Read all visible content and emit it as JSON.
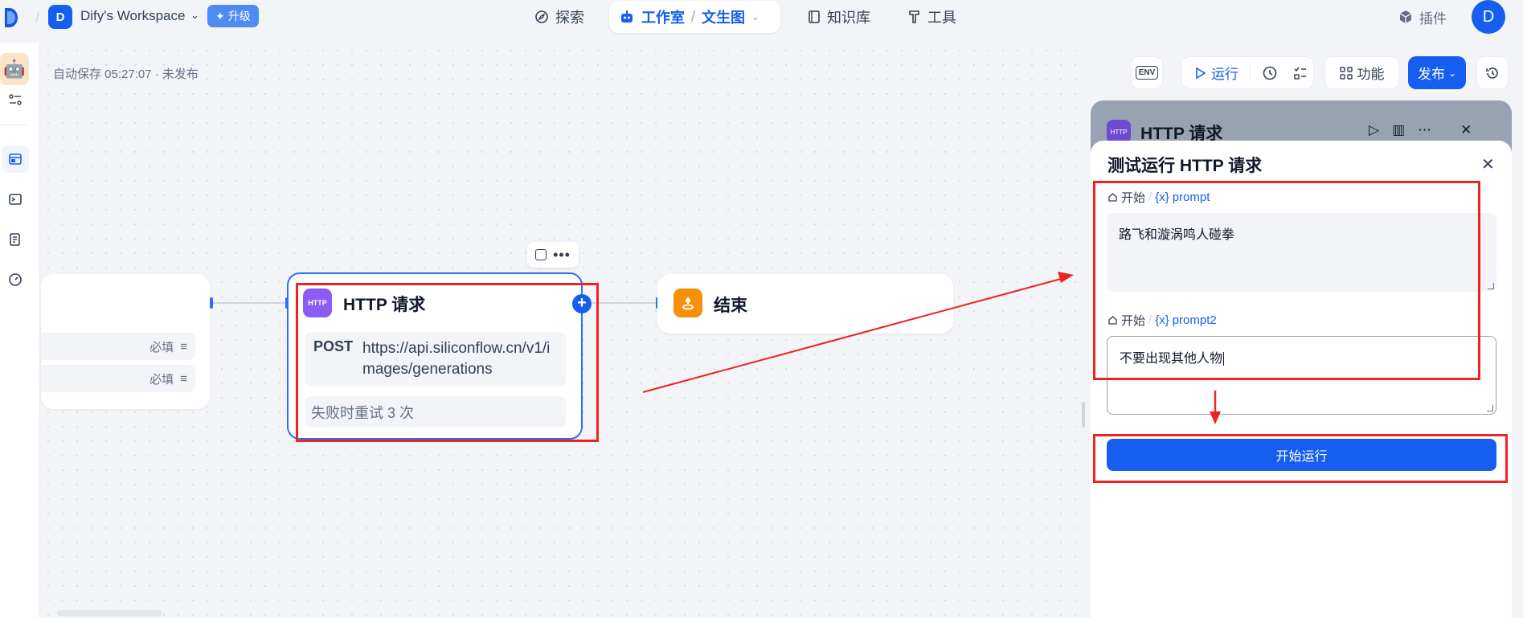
{
  "header": {
    "workspace_initial": "D",
    "workspace_name": "Dify's Workspace",
    "upgrade_label": "升级",
    "nav": {
      "explore": "探索",
      "studio": "工作室",
      "current_app": "文生图",
      "knowledge": "知识库",
      "tools": "工具",
      "plugins": "插件"
    },
    "user_initial": "D"
  },
  "canvas": {
    "autosave": "自动保存 05:27:07 · 未发布",
    "start_node": {
      "rows": [
        "必填",
        "必填"
      ]
    },
    "http_node": {
      "badge": "HTTP",
      "title": "HTTP 请求",
      "method": "POST",
      "url": "https://api.siliconflow.cn/v1/images/generations",
      "retry": "失败时重试 3 次"
    },
    "end_node": {
      "title": "结束"
    }
  },
  "toolbar": {
    "env": "ENV",
    "run": "运行",
    "features": "功能",
    "publish": "发布"
  },
  "panel": {
    "node_title": "HTTP 请求",
    "node_badge": "HTTP",
    "dialog_title": "测试运行 HTTP 请求",
    "fields": [
      {
        "source": "开始",
        "var": "prompt",
        "value": "路飞和漩涡鸣人碰拳"
      },
      {
        "source": "开始",
        "var": "prompt2",
        "value": "不要出现其他人物"
      }
    ],
    "start_button": "开始运行"
  },
  "colors": {
    "accent": "#155eef",
    "annotation": "#ee2222",
    "http_badge": "#8b5cf6",
    "end_badge": "#f79009"
  }
}
